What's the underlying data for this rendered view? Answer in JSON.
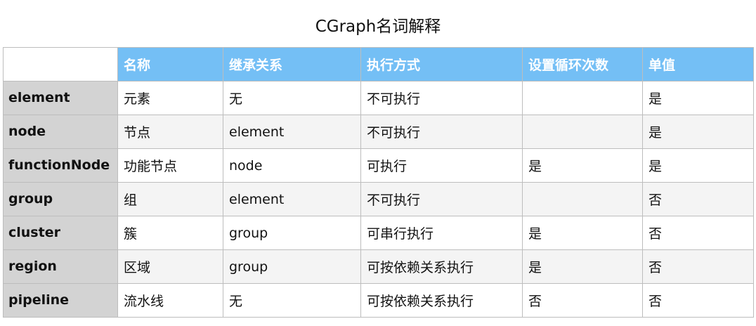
{
  "title": "CGraph名词解释",
  "columns": [
    "名称",
    "继承关系",
    "执行方式",
    "设置循环次数",
    "单值"
  ],
  "rows": [
    {
      "key": "element",
      "cells": [
        "元素",
        "无",
        "不可执行",
        "",
        "是"
      ]
    },
    {
      "key": "node",
      "cells": [
        "节点",
        "element",
        "不可执行",
        "",
        "是"
      ]
    },
    {
      "key": "functionNode",
      "cells": [
        "功能节点",
        "node",
        "可执行",
        "是",
        "是"
      ]
    },
    {
      "key": "group",
      "cells": [
        "组",
        "element",
        "不可执行",
        "",
        "否"
      ]
    },
    {
      "key": "cluster",
      "cells": [
        "簇",
        "group",
        "可串行执行",
        "是",
        "否"
      ]
    },
    {
      "key": "region",
      "cells": [
        "区域",
        "group",
        "可按依赖关系执行",
        "是",
        "否"
      ]
    },
    {
      "key": "pipeline",
      "cells": [
        "流水线",
        "无",
        "可按依赖关系执行",
        "否",
        "否"
      ]
    }
  ],
  "colors": {
    "header_bg": "#74bff5",
    "header_text": "#ffffff",
    "row_header_bg": "#d3d3d3",
    "alt_row_bg": "#f4f4f4",
    "border": "#bdbdbd"
  }
}
